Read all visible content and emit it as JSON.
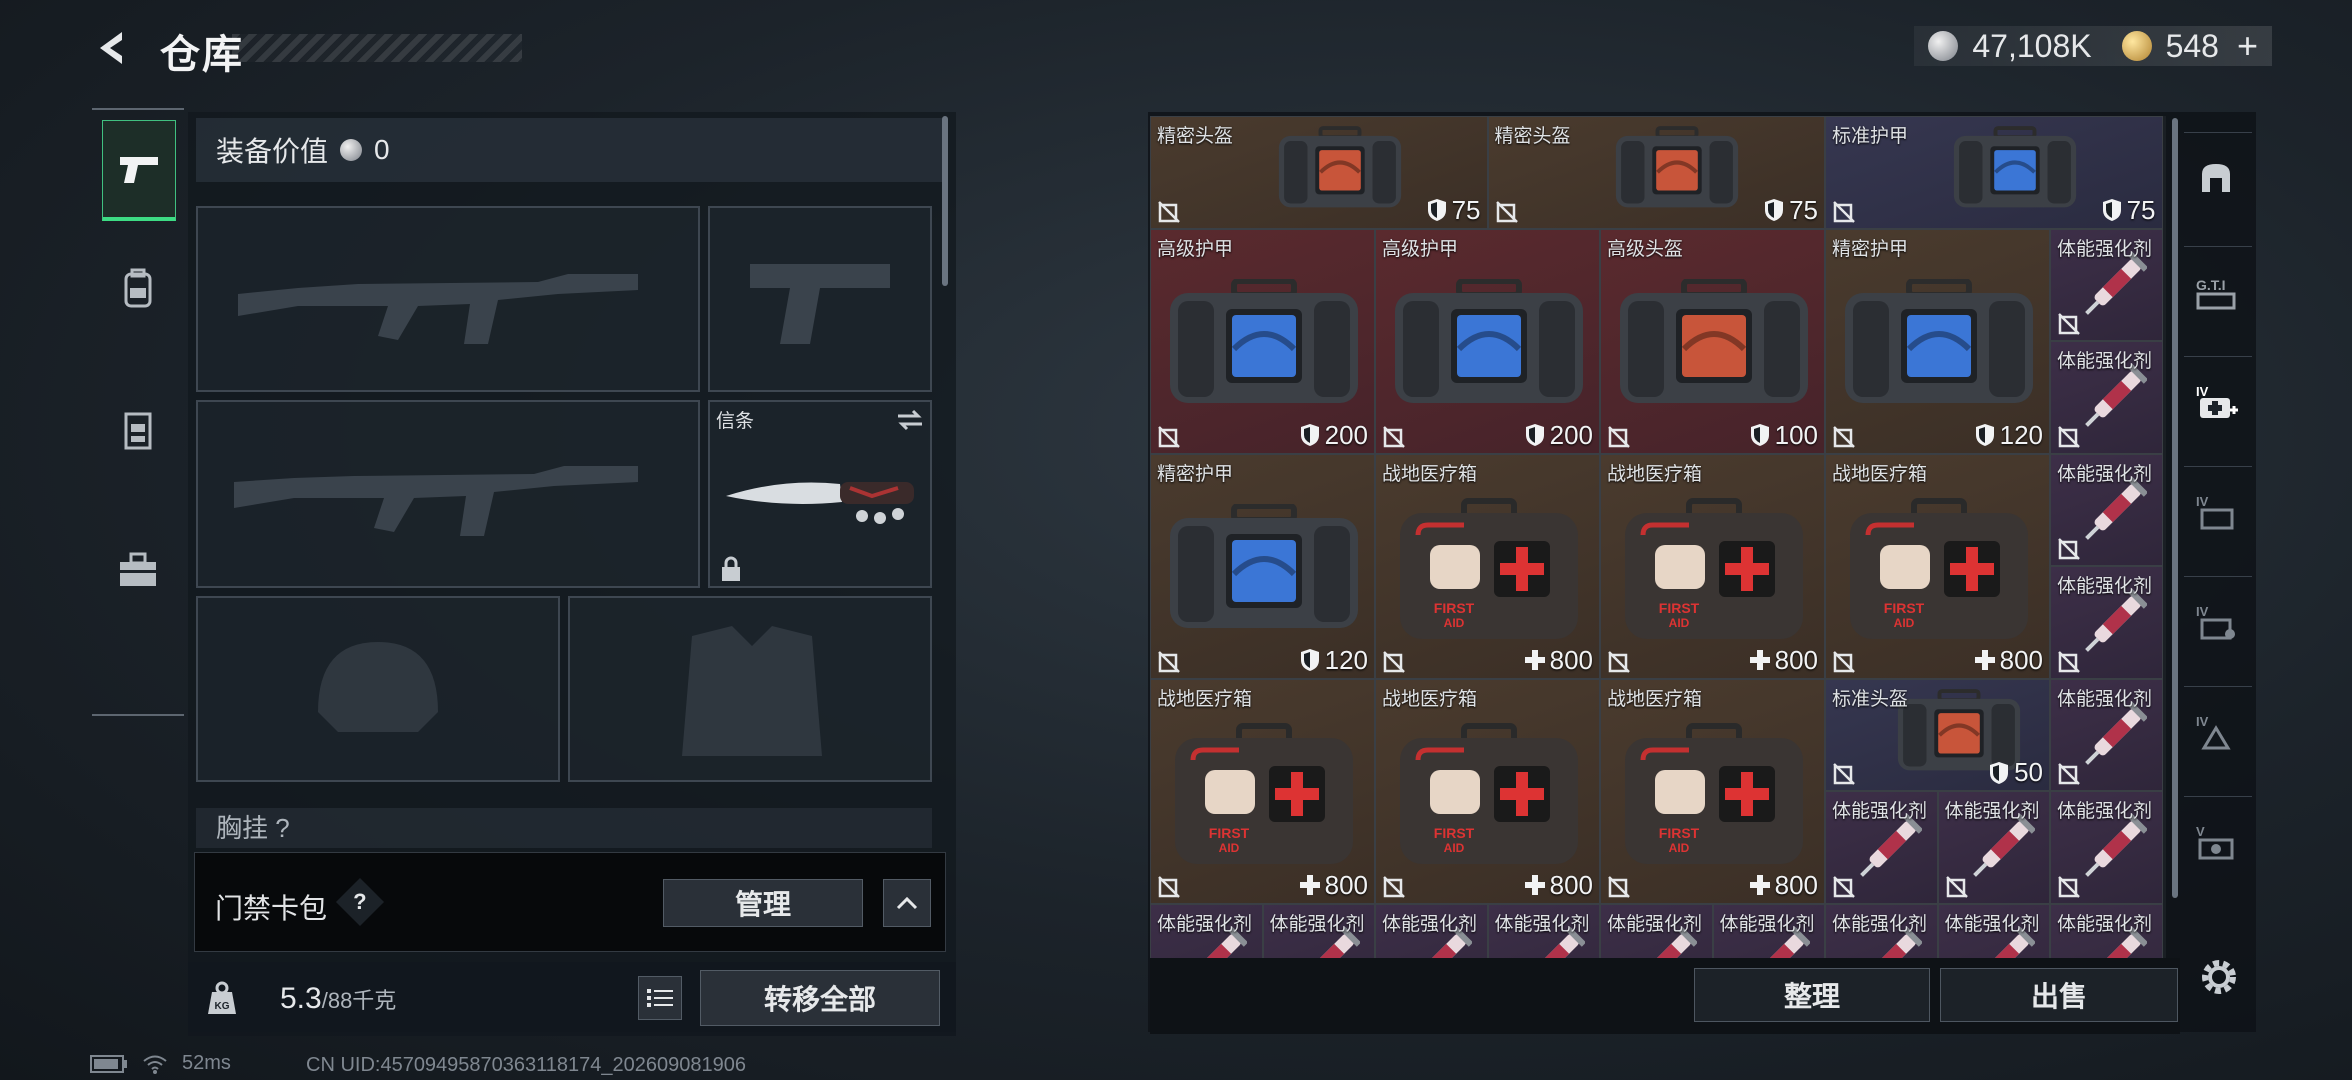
{
  "header": {
    "title": "仓库",
    "back_icon": "back-arrow-icon"
  },
  "currency": {
    "silver": "47,108K",
    "gold": "548",
    "plus": "+"
  },
  "left_rail": {
    "tabs": [
      "pistol-icon",
      "backpack-icon",
      "vest-icon",
      "toolbox-icon"
    ],
    "active": 0
  },
  "equipment": {
    "value_label": "装备价值",
    "value": "0",
    "melee_label": "信条",
    "chest_label": "胸挂 ?"
  },
  "keycard": {
    "label": "门禁卡包",
    "help": "?",
    "manage": "管理"
  },
  "bottom_left": {
    "weight": "5.3",
    "weight_max": "/88千克",
    "transfer_all": "转移全部"
  },
  "stash": {
    "items": [
      {
        "name": "精密头盔",
        "stat": "75",
        "stat_icon": "shield",
        "quality": "brown",
        "art": "helmet-case"
      },
      {
        "name": "精密头盔",
        "stat": "75",
        "stat_icon": "shield",
        "quality": "brown",
        "art": "helmet-case"
      },
      {
        "name": "标准护甲",
        "stat": "75",
        "stat_icon": "shield",
        "quality": "blue",
        "art": "armor-case"
      },
      {
        "name": "高级护甲",
        "stat": "200",
        "stat_icon": "shield",
        "quality": "red",
        "art": "armor-case"
      },
      {
        "name": "高级护甲",
        "stat": "200",
        "stat_icon": "shield",
        "quality": "red",
        "art": "armor-case"
      },
      {
        "name": "高级头盔",
        "stat": "100",
        "stat_icon": "shield",
        "quality": "red",
        "art": "helmet-case"
      },
      {
        "name": "精密护甲",
        "stat": "120",
        "stat_icon": "shield",
        "quality": "brown",
        "art": "armor-case"
      },
      {
        "name": "体能强化剂",
        "stat": "",
        "stat_icon": "",
        "quality": "purple",
        "art": "syringe"
      },
      {
        "name": "体能强化剂",
        "stat": "",
        "stat_icon": "",
        "quality": "purple",
        "art": "syringe"
      },
      {
        "name": "精密护甲",
        "stat": "120",
        "stat_icon": "shield",
        "quality": "brown",
        "art": "armor-case"
      },
      {
        "name": "战地医疗箱",
        "stat": "800",
        "stat_icon": "plus",
        "quality": "brown",
        "art": "medkit"
      },
      {
        "name": "战地医疗箱",
        "stat": "800",
        "stat_icon": "plus",
        "quality": "brown",
        "art": "medkit"
      },
      {
        "name": "战地医疗箱",
        "stat": "800",
        "stat_icon": "plus",
        "quality": "brown",
        "art": "medkit"
      },
      {
        "name": "体能强化剂",
        "stat": "",
        "stat_icon": "",
        "quality": "purple",
        "art": "syringe"
      },
      {
        "name": "体能强化剂",
        "stat": "",
        "stat_icon": "",
        "quality": "purple",
        "art": "syringe"
      },
      {
        "name": "战地医疗箱",
        "stat": "800",
        "stat_icon": "plus",
        "quality": "brown",
        "art": "medkit"
      },
      {
        "name": "战地医疗箱",
        "stat": "800",
        "stat_icon": "plus",
        "quality": "brown",
        "art": "medkit"
      },
      {
        "name": "战地医疗箱",
        "stat": "800",
        "stat_icon": "plus",
        "quality": "brown",
        "art": "medkit"
      },
      {
        "name": "标准头盔",
        "stat": "50",
        "stat_icon": "shield",
        "quality": "blue",
        "art": "helmet-case"
      },
      {
        "name": "体能强化剂",
        "stat": "",
        "stat_icon": "",
        "quality": "purple",
        "art": "syringe"
      },
      {
        "name": "体能强化剂",
        "stat": "",
        "stat_icon": "",
        "quality": "purple",
        "art": "syringe"
      },
      {
        "name": "体能强化剂",
        "stat": "",
        "stat_icon": "",
        "quality": "purple",
        "art": "syringe"
      },
      {
        "name": "体能强化剂",
        "stat": "",
        "stat_icon": "",
        "quality": "purple",
        "art": "syringe"
      },
      {
        "name": "体能强化剂",
        "stat": "",
        "stat_icon": "",
        "quality": "purple",
        "art": "syringe"
      },
      {
        "name": "体能强化剂",
        "stat": "",
        "stat_icon": "",
        "quality": "purple",
        "art": "syringe"
      },
      {
        "name": "体能强化剂",
        "stat": "",
        "stat_icon": "",
        "quality": "purple",
        "art": "syringe"
      },
      {
        "name": "体能强化剂",
        "stat": "",
        "stat_icon": "",
        "quality": "purple",
        "art": "syringe"
      },
      {
        "name": "体能强化剂",
        "stat": "",
        "stat_icon": "",
        "quality": "purple",
        "art": "syringe"
      },
      {
        "name": "体能强化剂",
        "stat": "",
        "stat_icon": "",
        "quality": "purple",
        "art": "syringe"
      },
      {
        "name": "体能强化剂",
        "stat": "",
        "stat_icon": "",
        "quality": "purple",
        "art": "syringe"
      },
      {
        "name": "体能强化剂",
        "stat": "",
        "stat_icon": "",
        "quality": "purple",
        "art": "syringe"
      },
      {
        "name": "体能强化剂",
        "stat": "",
        "stat_icon": "",
        "quality": "purple",
        "art": "syringe"
      }
    ],
    "sort": "整理",
    "sell": "出售"
  },
  "right_rail": {
    "tabs": [
      "stash-arch-icon",
      "gti-icon",
      "medical-icon",
      "case-iv-icon",
      "case-iv-2-icon",
      "case-iv-3-icon",
      "case-v-icon"
    ],
    "active": 2
  },
  "status": {
    "ping": "52ms",
    "uid": "CN UID:457094958703631181​74_202609081906"
  }
}
